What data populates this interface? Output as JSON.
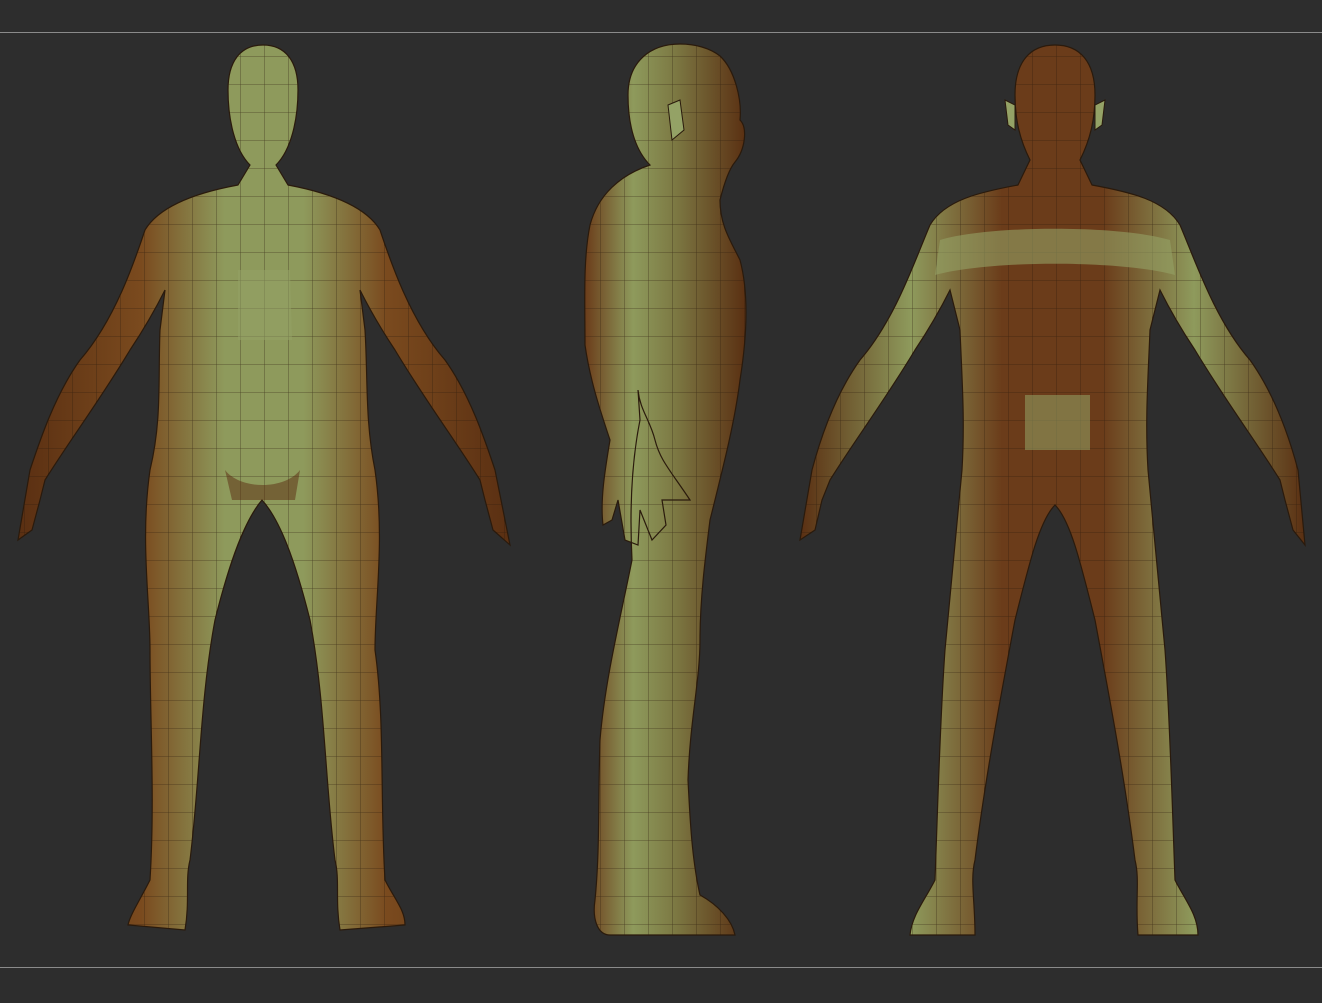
{
  "viewport": {
    "background": "#2d2d2d",
    "frame_line_color": "#8a8a8a"
  },
  "model": {
    "views": [
      "front",
      "side",
      "back"
    ],
    "material": {
      "light_band": "#8e9a5c",
      "dark_band": "#6b3c1a",
      "mid_tone": "#7a5a2a",
      "wire": "#2a1a0c"
    }
  }
}
